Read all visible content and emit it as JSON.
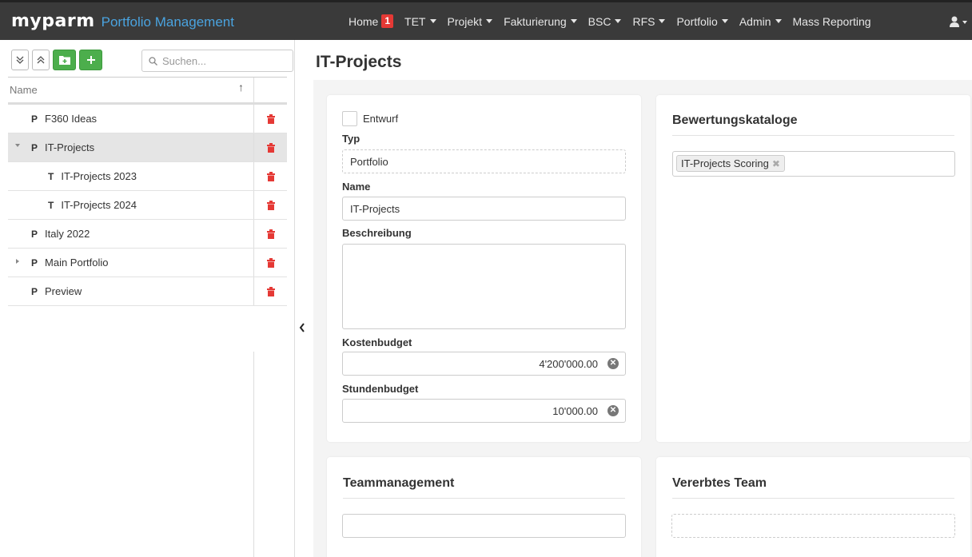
{
  "app": {
    "logo_text": "myparm",
    "title": "Portfolio Management"
  },
  "nav": {
    "items": [
      {
        "label": "Home",
        "badge": "1",
        "dropdown": false
      },
      {
        "label": "TET",
        "dropdown": true
      },
      {
        "label": "Projekt",
        "dropdown": true
      },
      {
        "label": "Fakturierung",
        "dropdown": true
      },
      {
        "label": "BSC",
        "dropdown": true
      },
      {
        "label": "RFS",
        "dropdown": true
      },
      {
        "label": "Portfolio",
        "dropdown": true
      },
      {
        "label": "Admin",
        "dropdown": true
      },
      {
        "label": "Mass Reporting",
        "dropdown": false
      }
    ],
    "user_icon": "user-icon"
  },
  "sidebar": {
    "search_placeholder": "Suchen...",
    "column_name": "Name",
    "sort_indicator": "↑",
    "rows": [
      {
        "type": "P",
        "label": "F360 Ideas"
      },
      {
        "type": "P",
        "label": "IT-Projects"
      },
      {
        "type": "T",
        "label": "IT-Projects 2023"
      },
      {
        "type": "T",
        "label": "IT-Projects 2024"
      },
      {
        "type": "P",
        "label": "Italy 2022"
      },
      {
        "type": "P",
        "label": "Main Portfolio"
      },
      {
        "type": "P",
        "label": "Preview"
      }
    ]
  },
  "main": {
    "page_title": "IT-Projects",
    "form": {
      "draft_label": "Entwurf",
      "type_label": "Typ",
      "type_value": "Portfolio",
      "name_label": "Name",
      "name_value": "IT-Projects",
      "description_label": "Beschreibung",
      "description_value": "",
      "cost_budget_label": "Kostenbudget",
      "cost_budget_value": "4'200'000.00",
      "hour_budget_label": "Stundenbudget",
      "hour_budget_value": "10'000.00"
    },
    "catalogs": {
      "title": "Bewertungskataloge",
      "tag": "IT-Projects Scoring"
    },
    "team": {
      "title": "Teammanagement"
    },
    "inherited_team": {
      "title": "Vererbtes Team"
    }
  },
  "colors": {
    "navbar": "#3a3a3a",
    "brand_accent": "#4aa3df",
    "badge": "#e53935",
    "add_button": "#4cae4c",
    "delete_icon": "#e53935"
  }
}
